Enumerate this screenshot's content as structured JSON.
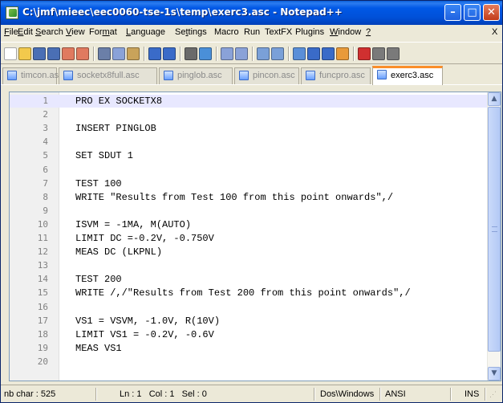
{
  "window": {
    "title": "C:\\jmf\\mieec\\eec0060-tse-1s\\temp\\exerc3.asc - Notepad++"
  },
  "title_buttons": {
    "minimize": "–",
    "maximize": "□",
    "close": "✕"
  },
  "menu": [
    {
      "key": "F",
      "rest": "ile"
    },
    {
      "key": "E",
      "rest": "dit"
    },
    {
      "key": "S",
      "rest": "earch"
    },
    {
      "key": "V",
      "rest": "iew"
    },
    {
      "pre": "For",
      "key": "m",
      "rest": "at"
    },
    {
      "key": "L",
      "rest": "anguage"
    },
    {
      "pre": "Se",
      "key": "t",
      "rest": "tings"
    },
    {
      "pre": "",
      "key": "",
      "rest": "Macro"
    },
    {
      "pre": "",
      "key": "",
      "rest": "Run"
    },
    {
      "pre": "",
      "key": "",
      "rest": "TextFX"
    },
    {
      "pre": "",
      "key": "",
      "rest": "Plugins"
    },
    {
      "key": "W",
      "rest": "indow"
    },
    {
      "key": "?",
      "rest": ""
    }
  ],
  "menu_close": "X",
  "toolbar_icons": [
    "new-file-icon",
    "open-file-icon",
    "save-icon",
    "save-all-icon",
    "close-icon",
    "close-all-icon",
    "cut-icon",
    "copy-icon",
    "paste-icon",
    "undo-icon",
    "redo-icon",
    "find-icon",
    "replace-icon",
    "zoom-in-icon",
    "zoom-out-icon",
    "sync-vertical-icon",
    "sync-horizontal-icon",
    "word-wrap-icon",
    "show-all-chars-icon",
    "indent-guide-icon",
    "user-lang-icon",
    "record-macro-icon",
    "stop-macro-icon",
    "play-macro-icon"
  ],
  "tabs": [
    {
      "label": "timcon.asc",
      "active": false
    },
    {
      "label": "socketx8full.asc",
      "active": false
    },
    {
      "label": "pinglob.asc",
      "active": false
    },
    {
      "label": "pincon.asc",
      "active": false
    },
    {
      "label": "funcpro.asc",
      "active": false
    },
    {
      "label": "exerc3.asc",
      "active": true
    }
  ],
  "editor": {
    "current_line": 1,
    "lines": [
      {
        "num": "1",
        "text": "PRO EX SOCKETX8"
      },
      {
        "num": "2",
        "text": ""
      },
      {
        "num": "3",
        "text": "INSERT PINGLOB"
      },
      {
        "num": "4",
        "text": ""
      },
      {
        "num": "5",
        "text": "SET SDUT 1"
      },
      {
        "num": "6",
        "text": ""
      },
      {
        "num": "7",
        "text": "TEST 100"
      },
      {
        "num": "8",
        "text": "WRITE \"Results from Test 100 from this point onwards\",/"
      },
      {
        "num": "9",
        "text": ""
      },
      {
        "num": "10",
        "text": "ISVM = -1MA, M(AUTO)"
      },
      {
        "num": "11",
        "text": "LIMIT DC =-0.2V, -0.750V"
      },
      {
        "num": "12",
        "text": "MEAS DC (LKPNL)"
      },
      {
        "num": "13",
        "text": ""
      },
      {
        "num": "14",
        "text": "TEST 200"
      },
      {
        "num": "15",
        "text": "WRITE /,/\"Results from Test 200 from this point onwards\",/"
      },
      {
        "num": "16",
        "text": ""
      },
      {
        "num": "17",
        "text": "VS1 = VSVM, -1.0V, R(10V)"
      },
      {
        "num": "18",
        "text": "LIMIT VS1 = -0.2V, -0.6V"
      },
      {
        "num": "19",
        "text": "MEAS VS1"
      },
      {
        "num": "20",
        "text": ""
      }
    ]
  },
  "scrollbar": {
    "up_arrow": "▲",
    "down_arrow": "▼"
  },
  "status": {
    "nb_char": "nb char : 525",
    "position": "Ln : 1   Col : 1   Sel : 0",
    "eol": "Dos\\Windows",
    "encoding": "ANSI",
    "mode": "INS"
  },
  "colors": {
    "active_tab_accent": "#fa8e2a",
    "current_line": "#e8e8ff",
    "titlebar": "#0058e6"
  }
}
